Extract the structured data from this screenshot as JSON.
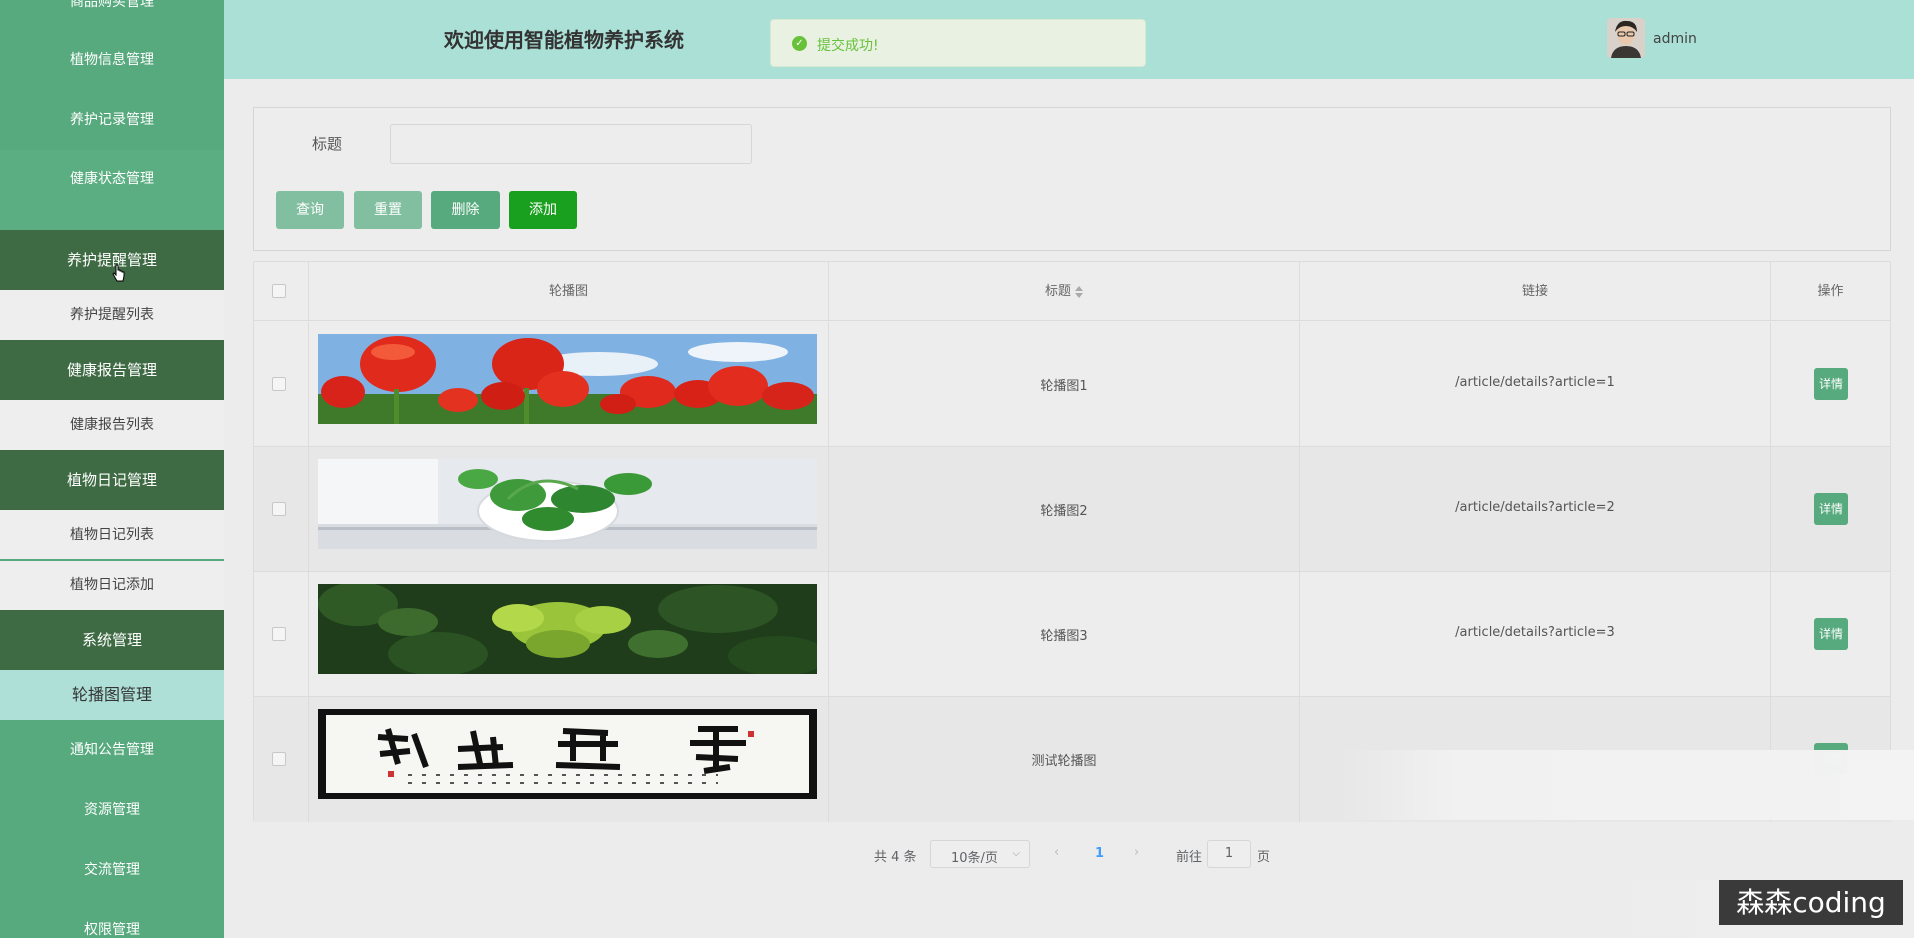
{
  "sidebar": {
    "top_partial": "商品购买管理",
    "items": [
      {
        "label": "植物信息管理"
      },
      {
        "label": "养护记录管理"
      },
      {
        "label": "健康状态管理"
      },
      {
        "label": "养护提醒管理"
      },
      {
        "label": "养护提醒列表"
      },
      {
        "label": "健康报告管理"
      },
      {
        "label": "健康报告列表"
      },
      {
        "label": "植物日记管理"
      },
      {
        "label": "植物日记列表"
      },
      {
        "label": "植物日记添加"
      },
      {
        "label": "系统管理"
      },
      {
        "label": "轮播图管理"
      },
      {
        "label": "通知公告管理"
      },
      {
        "label": "资源管理"
      },
      {
        "label": "交流管理"
      },
      {
        "label": "权限管理"
      }
    ]
  },
  "header": {
    "title": "欢迎使用智能植物养护系统",
    "toast": "提交成功!",
    "username": "admin"
  },
  "search": {
    "title_label": "标题",
    "title_value": "",
    "query_label": "查询",
    "reset_label": "重置",
    "delete_label": "删除",
    "add_label": "添加"
  },
  "table": {
    "columns": [
      "轮播图",
      "标题",
      "链接",
      "操作"
    ],
    "detail_label": "详情",
    "rows": [
      {
        "title": "轮播图1",
        "link": "/article/details?article=1",
        "image": "red-tulips"
      },
      {
        "title": "轮播图2",
        "link": "/article/details?article=2",
        "image": "green-plant-in-bowl"
      },
      {
        "title": "轮播图3",
        "link": "/article/details?article=3",
        "image": "green-leaves"
      },
      {
        "title": "测试轮播图",
        "link": "",
        "image": "calligraphy-scroll"
      }
    ]
  },
  "pagination": {
    "total": "共 4 条",
    "page_size": "10条/页",
    "current": "1",
    "goto_label": "前往",
    "goto_value": "1",
    "page_suffix": "页"
  },
  "watermark": "森森coding",
  "colors": {
    "sidebar": "#57a97e",
    "sidebar_group": "#3e6b44",
    "header": "#aae0d6",
    "accent": "#57a97e",
    "add_button": "#1aa01f",
    "success": "#67c23a"
  }
}
